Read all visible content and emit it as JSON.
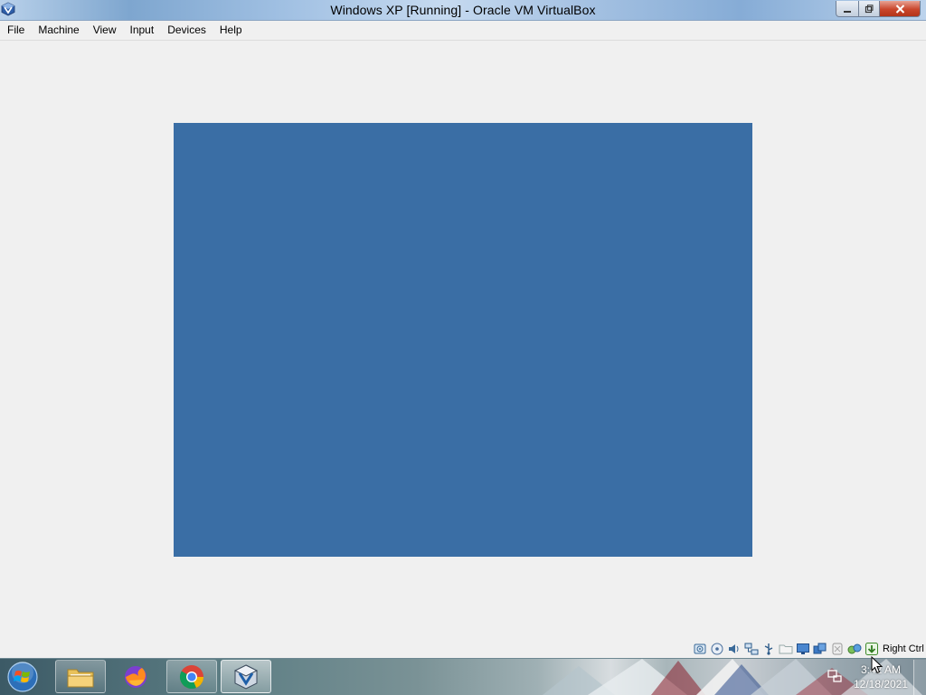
{
  "window": {
    "title": "Windows XP [Running] - Oracle VM VirtualBox",
    "app_icon": "virtualbox-icon",
    "controls": {
      "minimize": "minimize-icon",
      "maximize": "restore-icon",
      "close": "close-icon"
    }
  },
  "menu": [
    "File",
    "Machine",
    "View",
    "Input",
    "Devices",
    "Help"
  ],
  "vm_display": {
    "background_color": "#3a6ea5"
  },
  "status_bar": {
    "icons": [
      "hard-disk-icon",
      "optical-drive-icon",
      "audio-icon",
      "network-icon",
      "usb-icon",
      "shared-folders-icon",
      "display-icon",
      "video-capture-icon",
      "mouse-integration-icon",
      "cpu-icon",
      "guest-additions-icon",
      "keyboard-capture-icon"
    ],
    "host_key": "Right Ctrl"
  },
  "taskbar": {
    "start_icon": "windows-start-icon",
    "pinned": [
      {
        "name": "explorer",
        "icon": "folder-icon"
      },
      {
        "name": "firefox",
        "icon": "firefox-icon"
      },
      {
        "name": "chrome",
        "icon": "chrome-icon"
      },
      {
        "name": "virtualbox",
        "icon": "virtualbox-icon"
      }
    ],
    "tray_icon": "network-tray-icon",
    "clock": {
      "time": "3:42 AM",
      "date": "12/18/2021"
    }
  }
}
